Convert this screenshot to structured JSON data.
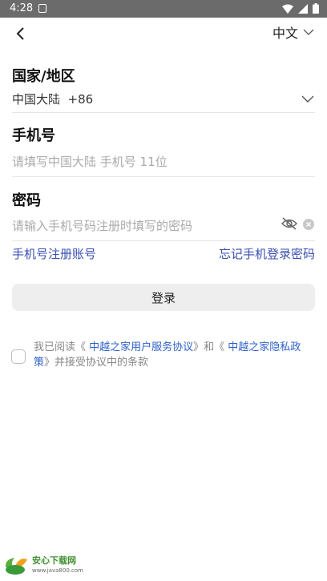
{
  "status": {
    "time": "4:28"
  },
  "header": {
    "lang_label": "中文"
  },
  "region": {
    "title": "国家/地区",
    "value": "中国大陆  +86"
  },
  "phone": {
    "title": "手机号",
    "placeholder": "请填写中国大陆 手机号 11位"
  },
  "password": {
    "title": "密码",
    "placeholder": "请输入手机号码注册时填写的密码"
  },
  "links": {
    "register": "手机号注册账号",
    "forgot": "忘记手机登录密码"
  },
  "login_label": "登录",
  "agreement": {
    "prefix": "我已阅读《",
    "terms": " 中越之家用户服务协议",
    "middle": "》和《",
    "privacy_1": " 中越之家隐私政",
    "privacy_2": "策",
    "suffix": "》并接受协议中的条款"
  },
  "watermark": {
    "name": "安心下载网",
    "url": "www.java800.com"
  },
  "colors": {
    "link": "#3a4fb0",
    "agreement_link": "#2e61c8",
    "status_bar": "#6b6b6b"
  }
}
